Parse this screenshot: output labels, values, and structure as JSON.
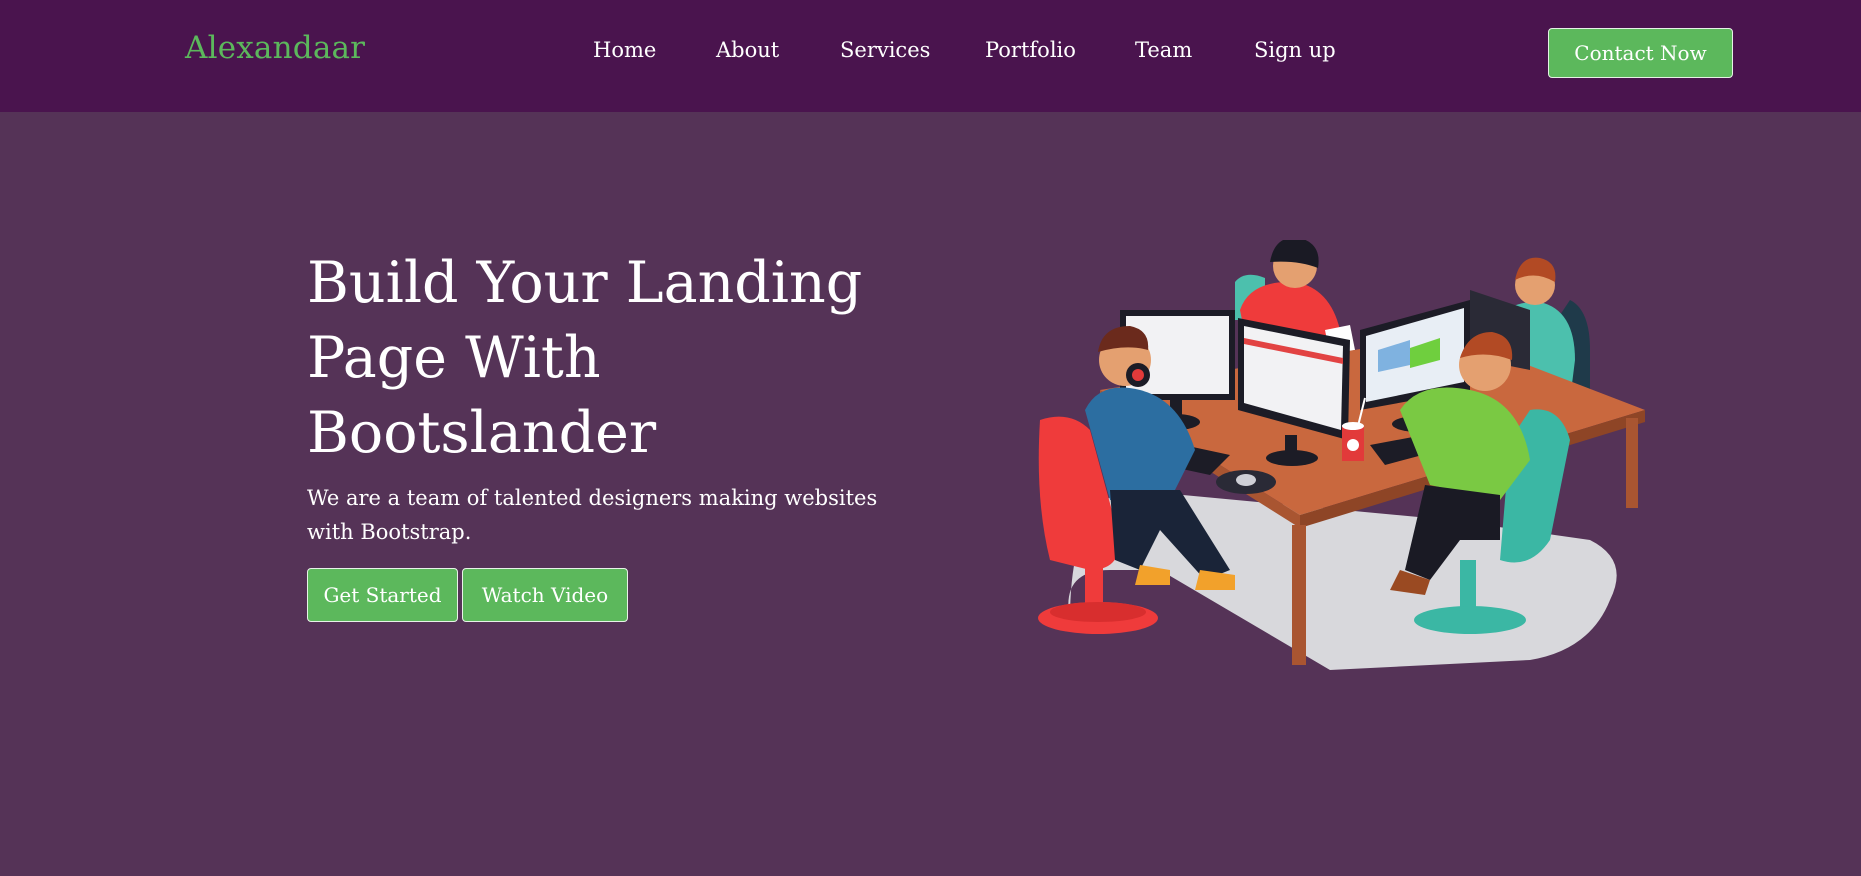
{
  "brand": {
    "name": "Alexandaar",
    "color": "#5cb85c"
  },
  "nav": {
    "items": [
      {
        "label": "Home"
      },
      {
        "label": "About"
      },
      {
        "label": "Services"
      },
      {
        "label": "Portfolio"
      },
      {
        "label": "Team"
      },
      {
        "label": "Sign up"
      }
    ],
    "contact_label": "Contact Now"
  },
  "hero": {
    "title": "Build Your Landing Page With Bootslander",
    "subtitle": "We are a team of talented designers making websites with Bootstrap.",
    "primary_cta": "Get Started",
    "secondary_cta": "Watch Video",
    "illustration": "team-working-at-computers-illustration"
  },
  "colors": {
    "navbar_bg": "#4a144e",
    "page_bg": "#553357",
    "accent": "#5cb85c"
  }
}
